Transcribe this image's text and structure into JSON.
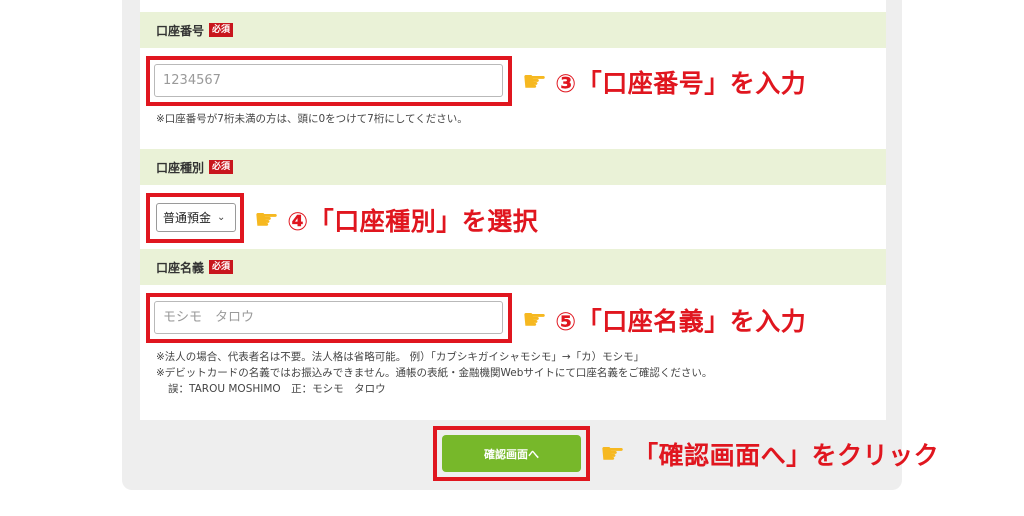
{
  "sections": {
    "account_number": {
      "label": "口座番号",
      "required_badge": "必須",
      "placeholder": "1234567",
      "note": "※口座番号が7桁未満の方は、頭に0をつけて7桁にしてください。"
    },
    "account_type": {
      "label": "口座種別",
      "required_badge": "必須",
      "selected_option": "普通預金"
    },
    "account_name": {
      "label": "口座名義",
      "required_badge": "必須",
      "placeholder": "モシモ　タロウ",
      "notes": [
        "※法人の場合、代表者名は不要。法人格は省略可能。 例）「カブシキガイシャモシモ」→「カ）モシモ」",
        "※デビットカードの名義ではお振込みできません。通帳の表紙・金融機関Webサイトにて口座名義をご確認ください。",
        "誤：TAROU MOSHIMO　正：モシモ　タロウ"
      ]
    }
  },
  "confirm_button": {
    "label": "確認画面へ"
  },
  "callouts": {
    "step3": "③「口座番号」を入力",
    "step4": "④「口座種別」を選択",
    "step5": "⑤「口座名義」を入力",
    "confirm": "「確認画面へ」をクリック"
  },
  "colors": {
    "highlight": "#e0161f",
    "section_header_bg": "#eaf2d7",
    "button": "#77b82a",
    "required_badge": "#c8161d",
    "hand_icon": "#f6b820"
  },
  "icons": {
    "pointing_hand": "pointing-hand-icon",
    "dropdown": "chevron-down-icon"
  }
}
